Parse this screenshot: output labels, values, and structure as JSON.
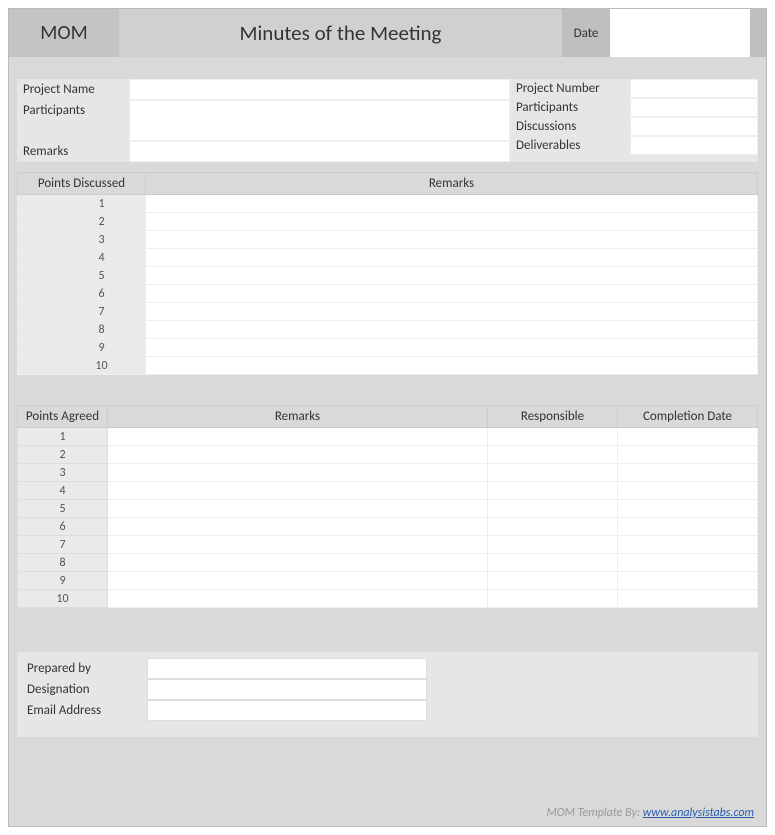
{
  "header": {
    "badge": "MOM",
    "title": "Minutes of the Meeting",
    "date_label": "Date",
    "date_value": ""
  },
  "meta_left": {
    "project_name": {
      "label": "Project Name",
      "value": ""
    },
    "participants": {
      "label": "Participants",
      "value": ""
    },
    "remarks": {
      "label": "Remarks",
      "value": ""
    }
  },
  "meta_right": {
    "project_number": {
      "label": "Project Number",
      "value": ""
    },
    "participants": {
      "label": "Participants",
      "value": ""
    },
    "discussions": {
      "label": "Discussions",
      "value": ""
    },
    "deliverables": {
      "label": "Deliverables",
      "value": ""
    }
  },
  "discussed": {
    "col_points": "Points Discussed",
    "col_remarks": "Remarks",
    "rows": [
      "1",
      "2",
      "3",
      "4",
      "5",
      "6",
      "7",
      "8",
      "9",
      "10"
    ]
  },
  "agreed": {
    "col_points": "Points Agreed",
    "col_remarks": "Remarks",
    "col_responsible": "Responsible",
    "col_completion": "Completion Date",
    "rows": [
      "1",
      "2",
      "3",
      "4",
      "5",
      "6",
      "7",
      "8",
      "9",
      "10"
    ]
  },
  "footer": {
    "prepared_by": {
      "label": "Prepared by",
      "value": ""
    },
    "designation": {
      "label": "Designation",
      "value": ""
    },
    "email": {
      "label": "Email Address",
      "value": ""
    }
  },
  "credit": {
    "prefix": "MOM Template By: ",
    "link_text": "www.analysistabs.com"
  }
}
